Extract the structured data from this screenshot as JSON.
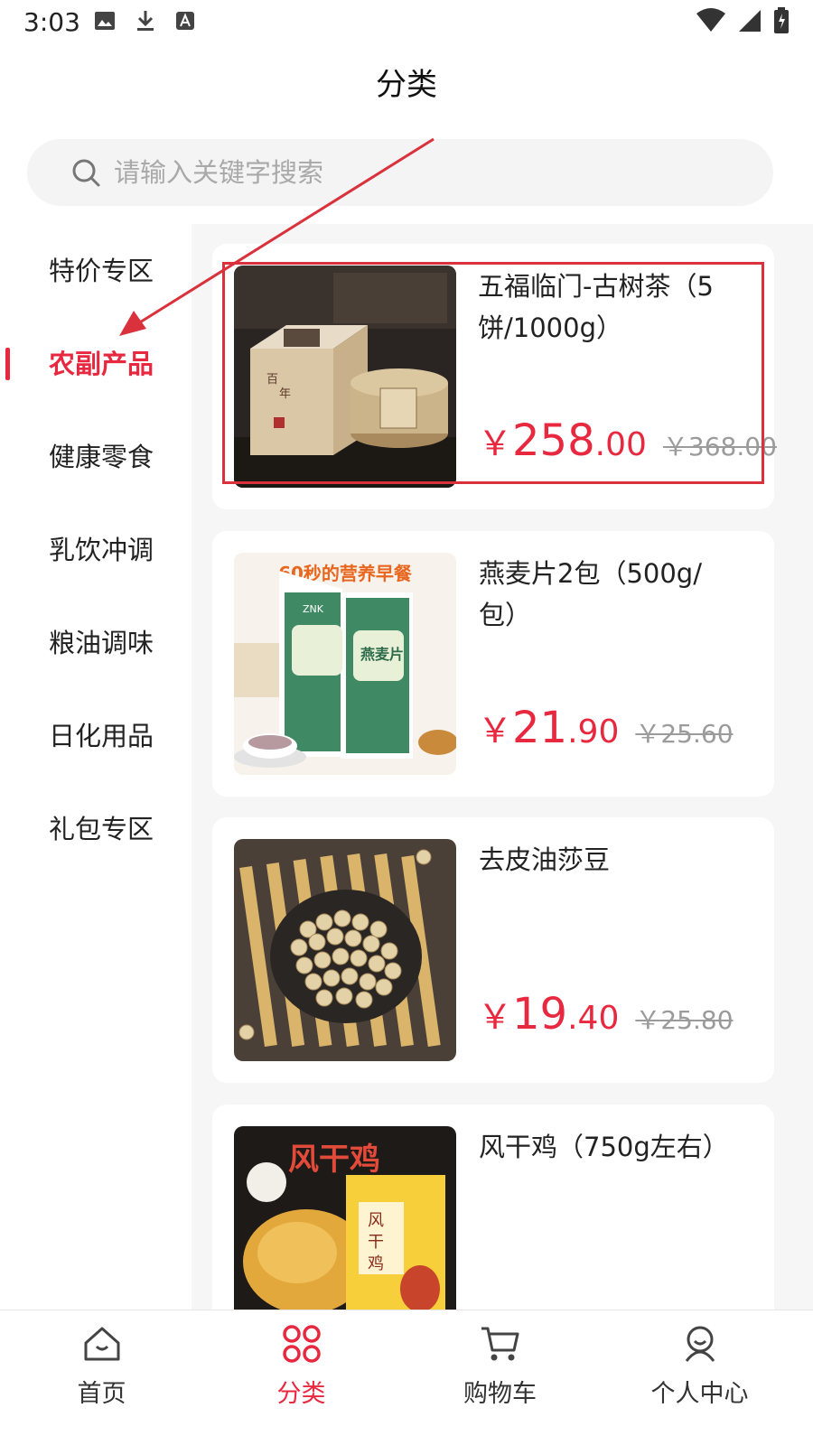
{
  "status_bar": {
    "time": "3:03"
  },
  "header": {
    "title": "分类"
  },
  "search": {
    "placeholder": "请输入关键字搜索"
  },
  "sidebar": {
    "items": [
      {
        "label": "特价专区",
        "active": false
      },
      {
        "label": "农副产品",
        "active": true
      },
      {
        "label": "健康零食",
        "active": false
      },
      {
        "label": "乳饮冲调",
        "active": false
      },
      {
        "label": "粮油调味",
        "active": false
      },
      {
        "label": "日化用品",
        "active": false
      },
      {
        "label": "礼包专区",
        "active": false
      }
    ]
  },
  "products": [
    {
      "name": "五福临门-古树茶（5饼/1000g）",
      "price_symbol": "￥",
      "price_int": "258",
      "price_dec": ".00",
      "original_price": "￥368.00"
    },
    {
      "name": "燕麦片2包（500g/包）",
      "price_symbol": "￥",
      "price_int": "21",
      "price_dec": ".90",
      "original_price": "￥25.60",
      "image_text": {
        "headline": "60秒的营养早餐",
        "brand": "ZNK",
        "pack_label": "燕麦片"
      }
    },
    {
      "name": "去皮油莎豆",
      "price_symbol": "￥",
      "price_int": "19",
      "price_dec": ".40",
      "original_price": "￥25.80"
    },
    {
      "name": "风干鸡（750g左右）",
      "price_symbol": "￥",
      "price_int": "",
      "price_dec": "",
      "original_price": "",
      "image_text": {
        "headline": "风干鸡"
      }
    }
  ],
  "bottom_nav": {
    "items": [
      {
        "label": "首页",
        "icon": "home-icon",
        "active": false
      },
      {
        "label": "分类",
        "icon": "category-icon",
        "active": true
      },
      {
        "label": "购物车",
        "icon": "cart-icon",
        "active": false
      },
      {
        "label": "个人中心",
        "icon": "user-icon",
        "active": false
      }
    ]
  },
  "colors": {
    "accent": "#e8283f",
    "annotation": "#d9323c"
  }
}
